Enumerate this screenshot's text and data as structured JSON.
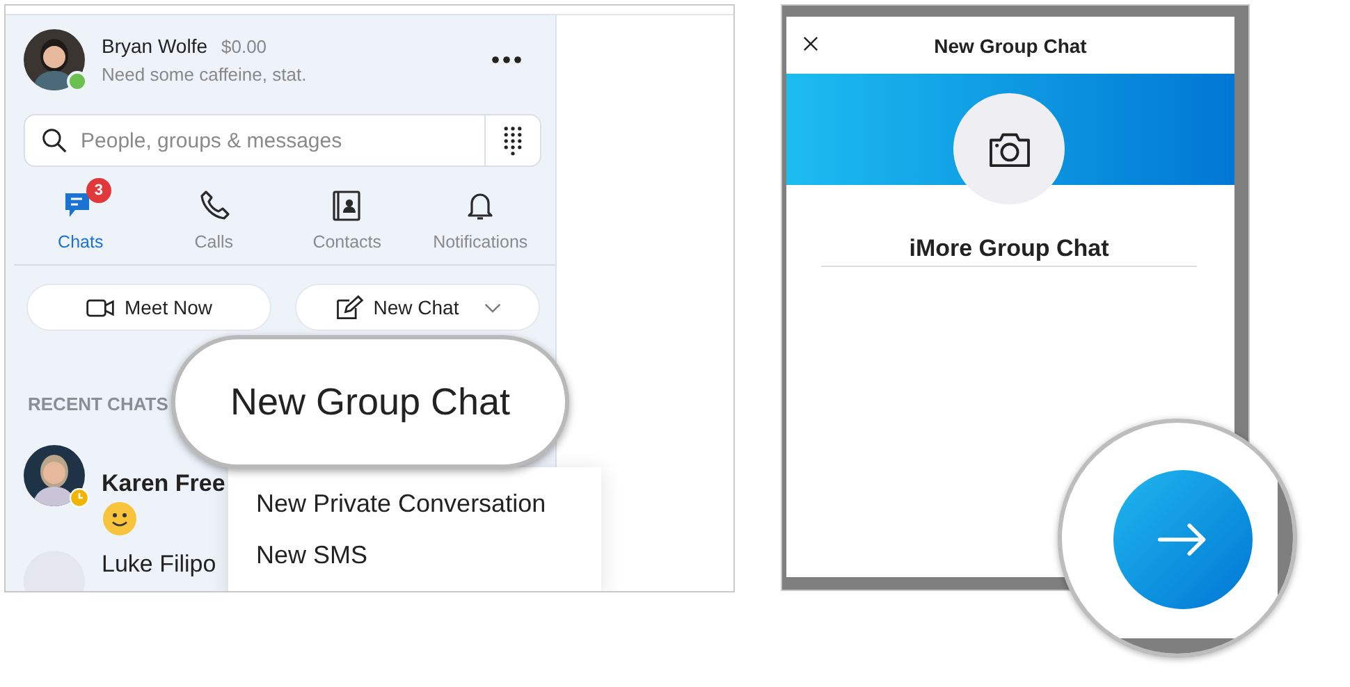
{
  "left_screenshot": {
    "profile": {
      "name": "Bryan Wolfe",
      "balance": "$0.00",
      "mood": "Need some caffeine, stat.",
      "online": true
    },
    "search": {
      "placeholder": "People, groups & messages"
    },
    "tabs": [
      {
        "label": "Chats",
        "selected": true,
        "badge": "3"
      },
      {
        "label": "Calls",
        "selected": false
      },
      {
        "label": "Contacts",
        "selected": false
      },
      {
        "label": "Notifications",
        "selected": false
      }
    ],
    "buttons": [
      {
        "label": "Meet Now",
        "kind": "meet"
      },
      {
        "label": "New Chat",
        "kind": "new"
      }
    ],
    "section_title": "RECENT CHATS",
    "chats": [
      {
        "name": "Karen Free",
        "unread": true,
        "away": true,
        "emoji": true
      },
      {
        "name": "Luke Filipo",
        "unread": false,
        "away": false,
        "kind": "initials",
        "emoji": false
      }
    ],
    "dropdown": {
      "items": [
        "New Private Conversation",
        "New SMS"
      ]
    },
    "callout": {
      "label": "New Group Chat"
    }
  },
  "right_screenshot": {
    "dialog": {
      "title": "New Group Chat",
      "group_name": "iMore Group Chat"
    },
    "callout": {
      "kind": "next-button"
    }
  }
}
